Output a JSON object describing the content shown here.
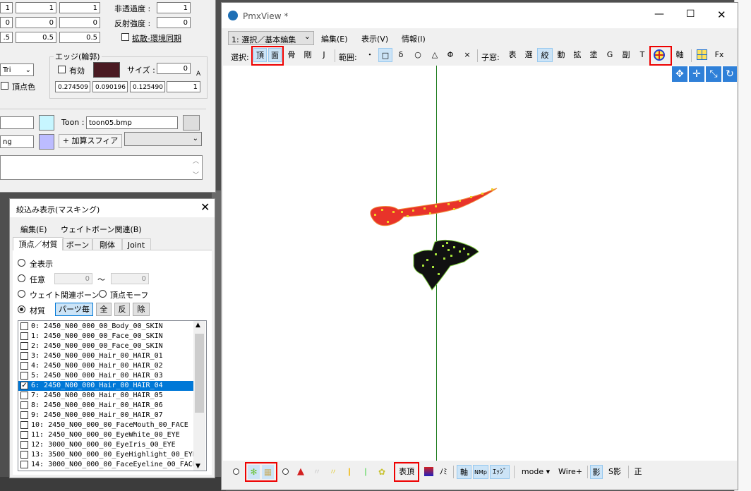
{
  "material_panel": {
    "row1": [
      "1",
      "1",
      "1"
    ],
    "row2": [
      "0",
      "0",
      "0"
    ],
    "row3": [
      ".5",
      "0.5",
      "0.5"
    ],
    "opacity_label": "非透過度 :",
    "opacity_value": "1",
    "reflect_label": "反射強度 :",
    "reflect_value": "0",
    "diffuse_sync": "拡散-環境同期",
    "edge_label": "エッジ(輪郭)",
    "tri_value": "Tri",
    "enabled_label": "有効",
    "size_label": "サイズ :",
    "size_value": "0",
    "vertex_color_label": "頂点色",
    "edge_rgba": [
      "0.274509",
      "0.090196",
      "0.125490",
      "1"
    ],
    "toon_label": "Toon :",
    "toon_value": "toon05.bmp",
    "sphere_file": "ng",
    "sphere_mode": "+ 加算スフィア",
    "edge_color": "#4a1a22",
    "A_mark": "A"
  },
  "masking_window": {
    "title": "絞込み表示(マスキング)",
    "menu": [
      "編集(E)",
      "ウェイトボーン関連(B)"
    ],
    "tabs": [
      "頂点／材質",
      "ボーン",
      "剛体",
      "Joint"
    ],
    "opt_all": "全表示",
    "opt_any": "任意",
    "any_from": "0",
    "tilde": "〜",
    "any_to": "0",
    "opt_weight": "ウェイト関連ボーン",
    "opt_morph": "頂点モーフ",
    "opt_material": "材質",
    "btn_parts": "パーツ毎",
    "btn_all": "全",
    "btn_invert": "反",
    "btn_remove": "除",
    "materials": [
      "0: 2450_N00_000_00_Body_00_SKIN",
      "1: 2450_N00_000_00_Face_00_SKIN",
      "2: 2450_N00_000_00_Face_00_SKIN",
      "3: 2450_N00_000_Hair_00_HAIR_01",
      "4: 2450_N00_000_Hair_00_HAIR_02",
      "5: 2450_N00_000_Hair_00_HAIR_03",
      "6: 2450_N00_000_Hair_00_HAIR_04",
      "7: 2450_N00_000_Hair_00_HAIR_05",
      "8: 2450_N00_000_Hair_00_HAIR_06",
      "9: 2450_N00_000_Hair_00_HAIR_07",
      "10: 2450_N00_000_00_FaceMouth_00_FACE",
      "11: 2450_N00_000_00_EyeWhite_00_EYE",
      "12: 3000_N00_000_00_EyeIris_00_EYE",
      "13: 3500_N00_000_00_EyeHighlight_00_EYE",
      "14: 3000_N00_000_00_FaceEyeline_00_FACE"
    ],
    "selected_index": 6
  },
  "pmxview": {
    "title": "PmxView *",
    "mode_select": "1: 選択／基本編集",
    "menu": [
      "編集(E)",
      "表示(V)",
      "情報(I)"
    ],
    "sel_label": "選択:",
    "sel_items": [
      "頂",
      "面",
      "骨",
      "剛",
      "J"
    ],
    "range_label": "範囲:",
    "range_items": [
      "・",
      "□",
      "δ",
      "○",
      "△",
      "Φ",
      "×"
    ],
    "child_label": "子窓:",
    "child_items": [
      "表",
      "選",
      "絞",
      "動",
      "拡",
      "塗",
      "G",
      "副",
      "T"
    ],
    "axis_label": "軸",
    "fx_label": "Fx",
    "bottom_items": [
      "表頂",
      "ﾉﾐ",
      "軸",
      "ｴｯｼﾞ",
      "mode ▾",
      "Wire+",
      "影",
      "S影",
      "正"
    ],
    "bottom_nm": "NMp"
  },
  "colors": {
    "highlight_red": "#ee0000",
    "hair_red": "#e8332a",
    "selection_blue": "#0078d7"
  }
}
